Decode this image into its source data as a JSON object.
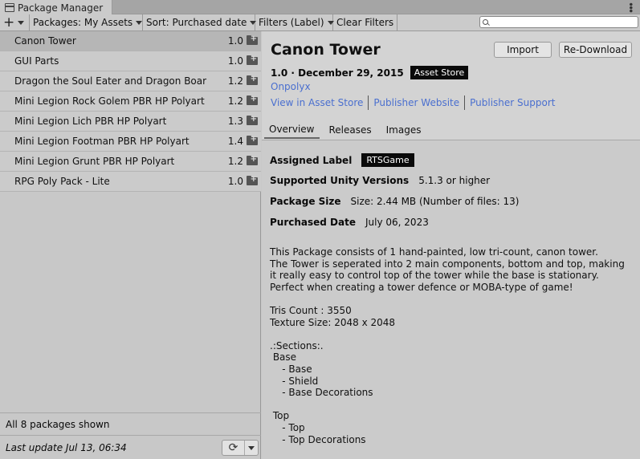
{
  "window": {
    "tab_title": "Package Manager"
  },
  "toolbar": {
    "add_icon": "plus-icon",
    "packages_label": "Packages: My Assets",
    "sort_label": "Sort: Purchased date",
    "filters_label": "Filters (Label)",
    "clear_filters_label": "Clear Filters",
    "search_placeholder": ""
  },
  "packages": [
    {
      "name": "Canon Tower",
      "version": "1.0",
      "selected": true
    },
    {
      "name": "GUI Parts",
      "version": "1.0"
    },
    {
      "name": "Dragon the Soul Eater and Dragon Boar",
      "version": "1.2"
    },
    {
      "name": "Mini Legion Rock Golem PBR HP Polyart",
      "version": "1.2"
    },
    {
      "name": "Mini Legion Lich PBR HP Polyart",
      "version": "1.3"
    },
    {
      "name": "Mini Legion Footman PBR HP Polyart",
      "version": "1.4"
    },
    {
      "name": "Mini Legion Grunt PBR HP Polyart",
      "version": "1.2"
    },
    {
      "name": "RPG Poly Pack - Lite",
      "version": "1.0"
    }
  ],
  "list_status": "All 8 packages shown",
  "footer": {
    "last_update": "Last update Jul 13, 06:34"
  },
  "details": {
    "title": "Canon Tower",
    "import_label": "Import",
    "redownload_label": "Re-Download",
    "version_date": "1.0 · December 29, 2015",
    "source_badge": "Asset Store",
    "author": "Onpolyx",
    "links": [
      "View in Asset Store",
      "Publisher Website",
      "Publisher Support"
    ],
    "tabs": [
      "Overview",
      "Releases",
      "Images"
    ],
    "assigned_label_title": "Assigned Label",
    "assigned_label_value": "RTSGame",
    "unity_versions_title": "Supported Unity Versions",
    "unity_versions_value": "5.1.3 or higher",
    "package_size_title": "Package Size",
    "package_size_value": "Size: 2.44 MB (Number of files: 13)",
    "purchased_date_title": "Purchased Date",
    "purchased_date_value": "July 06, 2023",
    "description": "This Package consists of 1 hand-painted, low tri-count, canon tower.\nThe Tower is seperated into 2 main components, bottom and top, making it really easy to control top of the tower while the base is stationary.\nPerfect when creating a tower defence or MOBA-type of game!\n\nTris Count : 3550\nTexture Size: 2048 x 2048\n\n.:Sections:.\n Base\n    - Base\n    - Shield\n    - Base Decorations\n\n Top\n    - Top\n    - Top Decorations"
  },
  "colors": {
    "link": "#4a6fcf",
    "badge_bg": "#0a0a0a",
    "selected_row": "#b6b6b6"
  }
}
